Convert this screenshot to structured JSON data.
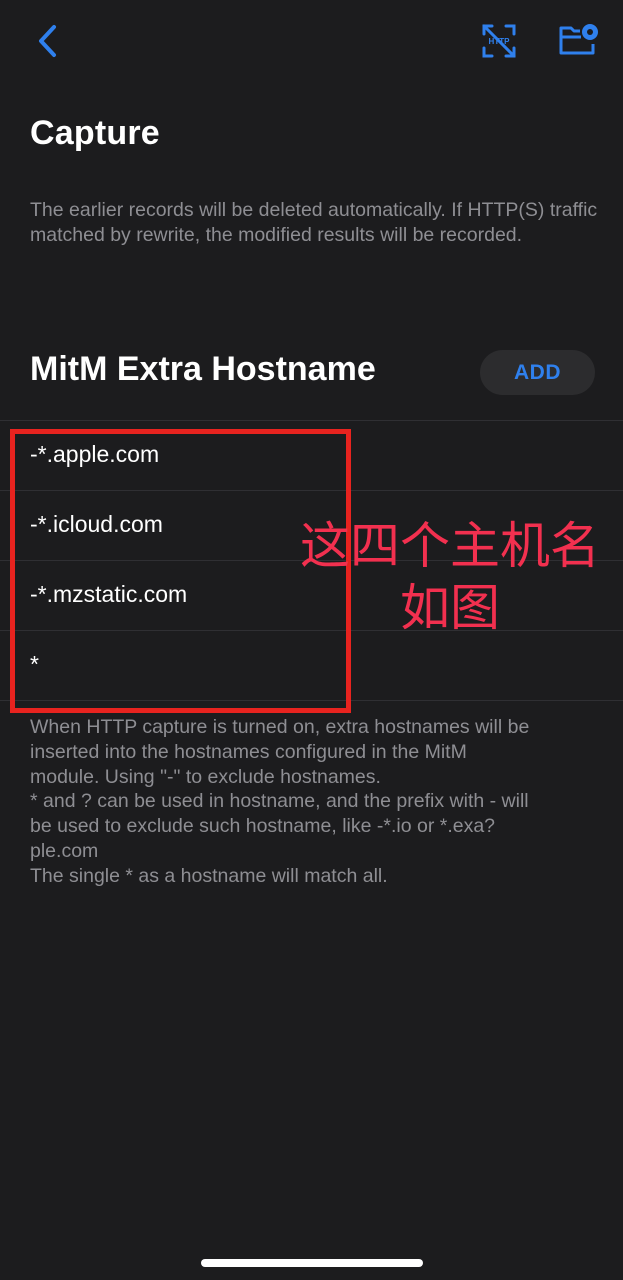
{
  "nav": {
    "back_icon": "chevron-left-icon",
    "http_capture_icon": "http-capture-off-icon",
    "http_capture_label": "HTTP",
    "folder_icon": "folder-settings-icon",
    "accent_color": "#2f80ed"
  },
  "page_title": "Capture",
  "capture_description": "The earlier records will be deleted automatically. If HTTP(S) traffic matched by rewrite, the modified results will be recorded.",
  "mitm_section": {
    "title": "MitM Extra Hostname",
    "add_label": "ADD",
    "hostnames": [
      "-*.apple.com",
      "-*.icloud.com",
      "-*.mzstatic.com",
      "*"
    ]
  },
  "footer_description": {
    "lines": [
      "When HTTP capture is turned on, extra hostnames will be",
      "inserted into the hostnames configured in the MitM",
      "module. Using \"-\" to exclude hostnames.",
      "* and ? can be used in hostname, and the prefix with - will",
      "be used to exclude such hostname, like -*.io or *.exa?",
      "ple.com",
      "The single * as a hostname will match all."
    ]
  },
  "annotation": {
    "line1": "这四个主机名",
    "line2": "如图",
    "color": "#e8231f"
  }
}
